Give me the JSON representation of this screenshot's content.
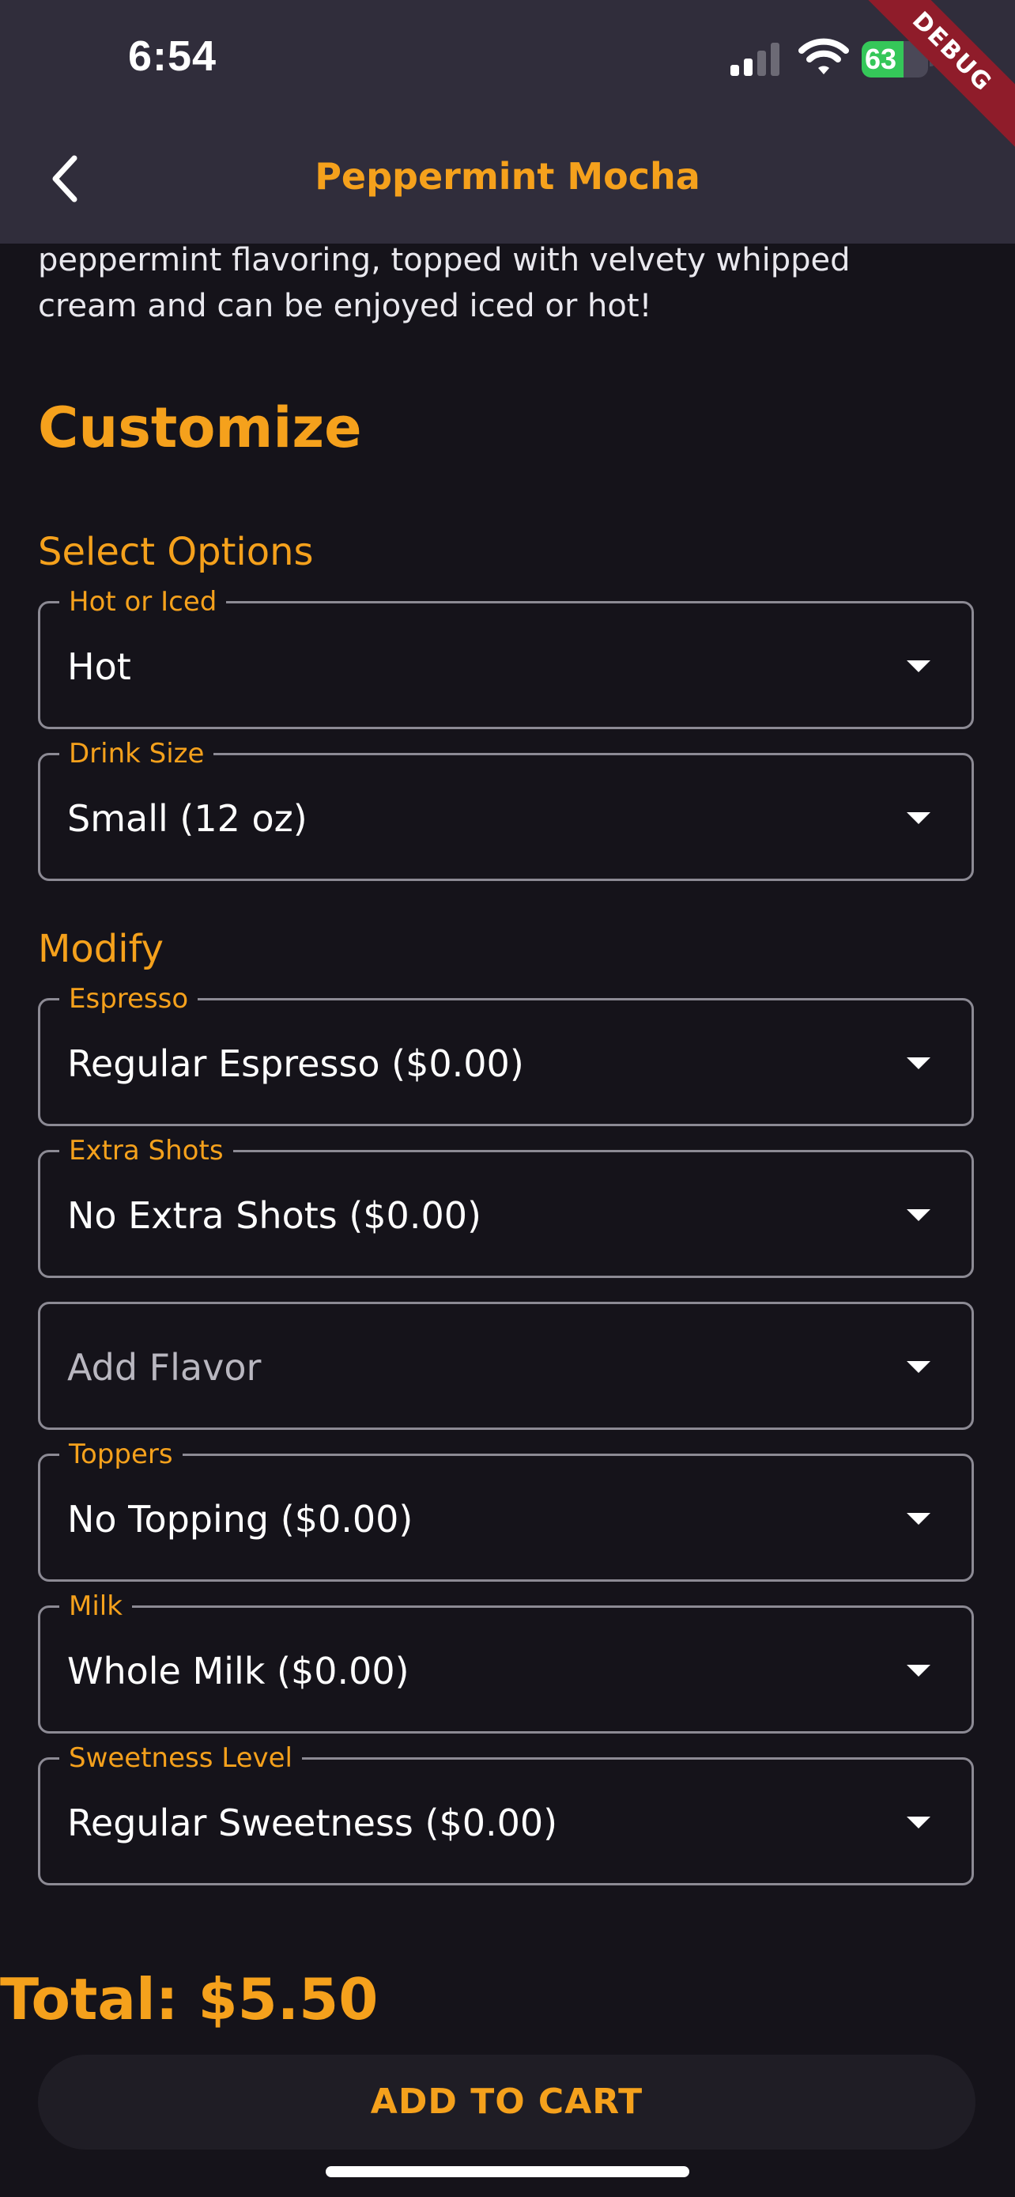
{
  "status_bar": {
    "time": "6:54",
    "battery": "63",
    "battery_level": 0.63
  },
  "debug_banner": "DEBUG",
  "nav": {
    "title": "Peppermint Mocha",
    "back_icon": "chevron-left-icon"
  },
  "description": {
    "line1": "peppermint flavoring, topped with velvety whipped",
    "line2": "cream and can be enjoyed iced or hot!"
  },
  "customize_heading": "Customize",
  "select_options": {
    "heading": "Select Options",
    "fields": [
      {
        "label": "Hot or Iced",
        "value": "Hot"
      },
      {
        "label": "Drink Size",
        "value": "Small (12 oz)"
      }
    ]
  },
  "modify": {
    "heading": "Modify",
    "fields": [
      {
        "label": "Espresso",
        "value": "Regular Espresso ($0.00)"
      },
      {
        "label": "Extra Shots",
        "value": "No Extra Shots ($0.00)"
      },
      {
        "placeholder": "Add Flavor"
      },
      {
        "label": "Toppers",
        "value": "No Topping ($0.00)"
      },
      {
        "label": "Milk",
        "value": "Whole Milk ($0.00)"
      },
      {
        "label": "Sweetness Level",
        "value": "Regular Sweetness ($0.00)"
      }
    ]
  },
  "total": "Total: $5.50",
  "add_to_cart_label": "ADD TO CART",
  "colors": {
    "accent": "#f5a11c",
    "background": "#15131a",
    "app_bar": "#302d3b",
    "button_bg": "#1f1d25"
  }
}
